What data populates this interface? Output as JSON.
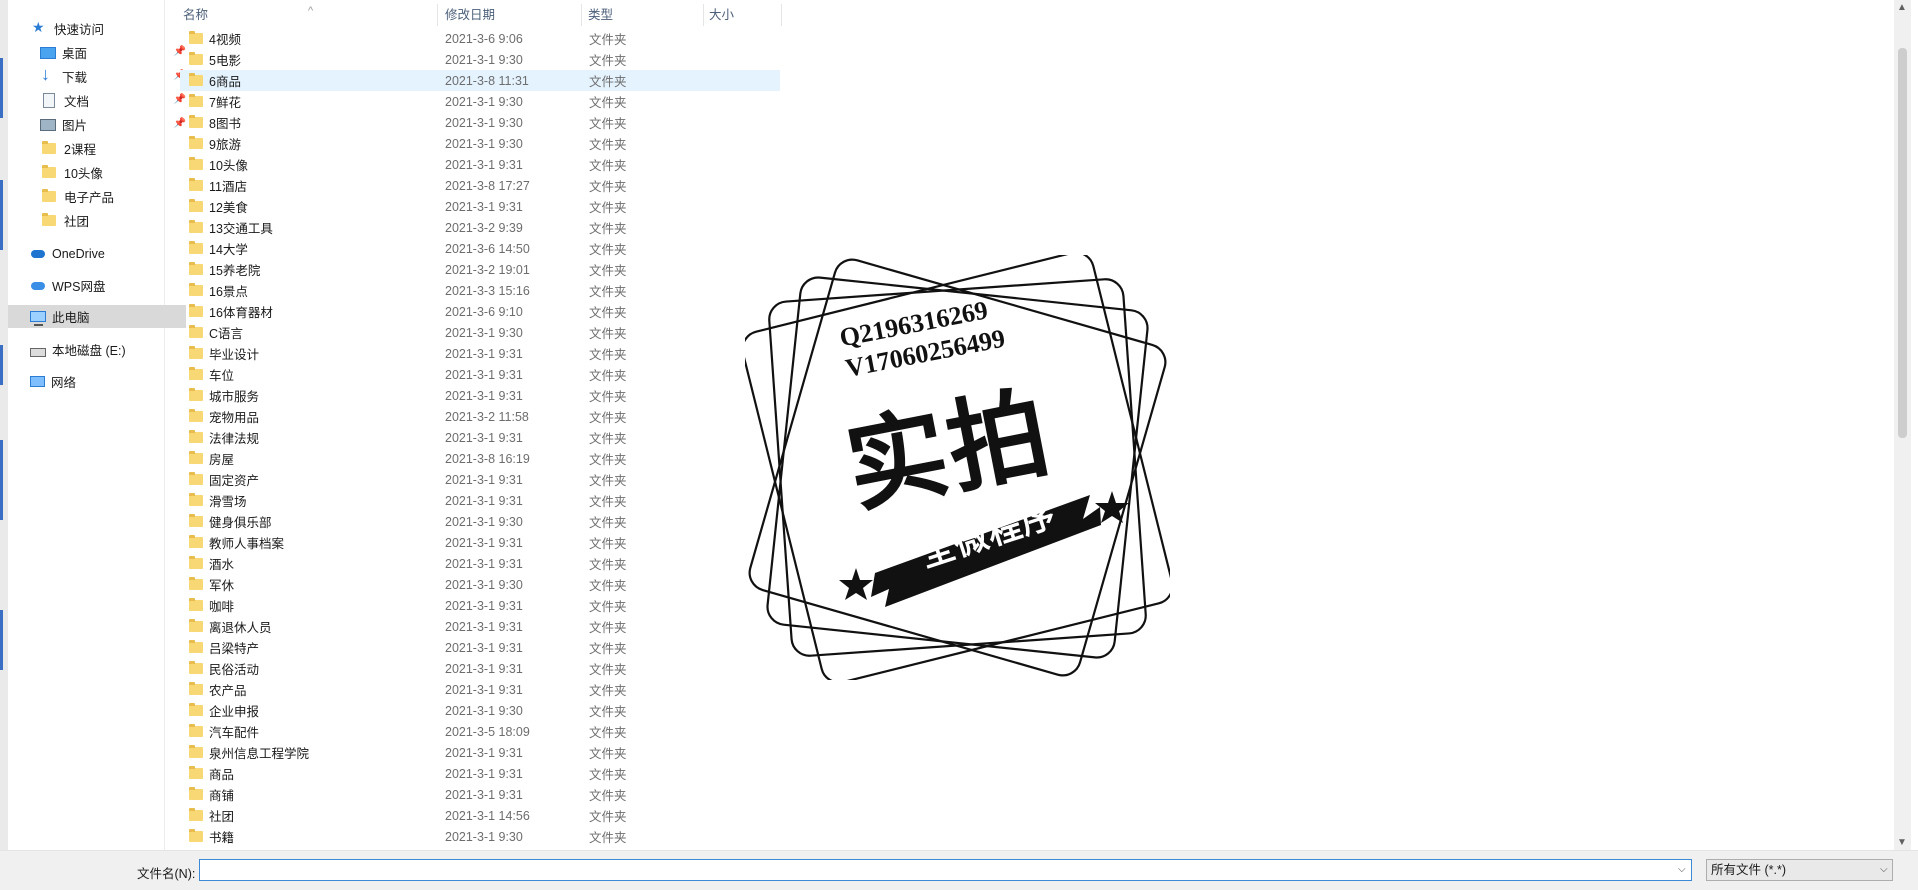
{
  "nav": {
    "quick_access": "快速访问",
    "items": [
      {
        "label": "桌面",
        "icon": "desktop-icon",
        "pinned": true
      },
      {
        "label": "下载",
        "icon": "download-icon",
        "pinned": true
      },
      {
        "label": "文档",
        "icon": "document-icon",
        "pinned": true
      },
      {
        "label": "图片",
        "icon": "pictures-icon",
        "pinned": true
      },
      {
        "label": "2课程",
        "icon": "folder-icon"
      },
      {
        "label": "10头像",
        "icon": "folder-icon"
      },
      {
        "label": "电子产品",
        "icon": "folder-icon"
      },
      {
        "label": "社团",
        "icon": "folder-icon"
      }
    ],
    "onedrive": "OneDrive",
    "wps": "WPS网盘",
    "this_pc": "此电脑",
    "local_disk": "本地磁盘 (E:)",
    "network": "网络",
    "pin_glyph": "📌"
  },
  "columns": {
    "name": "名称",
    "date": "修改日期",
    "type": "类型",
    "size": "大小"
  },
  "rows": [
    {
      "name": "4视频",
      "date": "2021-3-6 9:06",
      "type": "文件夹"
    },
    {
      "name": "5电影",
      "date": "2021-3-1 9:30",
      "type": "文件夹"
    },
    {
      "name": "6商品",
      "date": "2021-3-8 11:31",
      "type": "文件夹"
    },
    {
      "name": "7鲜花",
      "date": "2021-3-1 9:30",
      "type": "文件夹"
    },
    {
      "name": "8图书",
      "date": "2021-3-1 9:30",
      "type": "文件夹"
    },
    {
      "name": "9旅游",
      "date": "2021-3-1 9:30",
      "type": "文件夹"
    },
    {
      "name": "10头像",
      "date": "2021-3-1 9:31",
      "type": "文件夹"
    },
    {
      "name": "11酒店",
      "date": "2021-3-8 17:27",
      "type": "文件夹"
    },
    {
      "name": "12美食",
      "date": "2021-3-1 9:31",
      "type": "文件夹"
    },
    {
      "name": "13交通工具",
      "date": "2021-3-2 9:39",
      "type": "文件夹"
    },
    {
      "name": "14大学",
      "date": "2021-3-6 14:50",
      "type": "文件夹"
    },
    {
      "name": "15养老院",
      "date": "2021-3-2 19:01",
      "type": "文件夹"
    },
    {
      "name": "16景点",
      "date": "2021-3-3 15:16",
      "type": "文件夹"
    },
    {
      "name": "16体育器材",
      "date": "2021-3-6 9:10",
      "type": "文件夹"
    },
    {
      "name": "C语言",
      "date": "2021-3-1 9:30",
      "type": "文件夹"
    },
    {
      "name": "毕业设计",
      "date": "2021-3-1 9:31",
      "type": "文件夹"
    },
    {
      "name": "车位",
      "date": "2021-3-1 9:31",
      "type": "文件夹"
    },
    {
      "name": "城市服务",
      "date": "2021-3-1 9:31",
      "type": "文件夹"
    },
    {
      "name": "宠物用品",
      "date": "2021-3-2 11:58",
      "type": "文件夹"
    },
    {
      "name": "法律法规",
      "date": "2021-3-1 9:31",
      "type": "文件夹"
    },
    {
      "name": "房屋",
      "date": "2021-3-8 16:19",
      "type": "文件夹"
    },
    {
      "name": "固定资产",
      "date": "2021-3-1 9:31",
      "type": "文件夹"
    },
    {
      "name": "滑雪场",
      "date": "2021-3-1 9:31",
      "type": "文件夹"
    },
    {
      "name": "健身俱乐部",
      "date": "2021-3-1 9:30",
      "type": "文件夹"
    },
    {
      "name": "教师人事档案",
      "date": "2021-3-1 9:31",
      "type": "文件夹"
    },
    {
      "name": "酒水",
      "date": "2021-3-1 9:31",
      "type": "文件夹"
    },
    {
      "name": "军休",
      "date": "2021-3-1 9:30",
      "type": "文件夹"
    },
    {
      "name": "咖啡",
      "date": "2021-3-1 9:31",
      "type": "文件夹"
    },
    {
      "name": "离退休人员",
      "date": "2021-3-1 9:31",
      "type": "文件夹"
    },
    {
      "name": "吕梁特产",
      "date": "2021-3-1 9:31",
      "type": "文件夹"
    },
    {
      "name": "民俗活动",
      "date": "2021-3-1 9:31",
      "type": "文件夹"
    },
    {
      "name": "农产品",
      "date": "2021-3-1 9:31",
      "type": "文件夹"
    },
    {
      "name": "企业申报",
      "date": "2021-3-1 9:30",
      "type": "文件夹"
    },
    {
      "name": "汽车配件",
      "date": "2021-3-5 18:09",
      "type": "文件夹"
    },
    {
      "name": "泉州信息工程学院",
      "date": "2021-3-1 9:31",
      "type": "文件夹"
    },
    {
      "name": "商品",
      "date": "2021-3-1 9:31",
      "type": "文件夹"
    },
    {
      "name": "商铺",
      "date": "2021-3-1 9:31",
      "type": "文件夹"
    },
    {
      "name": "社团",
      "date": "2021-3-1 14:56",
      "type": "文件夹"
    },
    {
      "name": "书籍",
      "date": "2021-3-1 9:30",
      "type": "文件夹"
    }
  ],
  "hovered_row": 2,
  "bottom": {
    "filename_label": "文件名(N):",
    "filename_value": "",
    "filetype_value": "所有文件 (*.*)"
  },
  "watermark": {
    "line1": "Q2196316269",
    "line2": "V17060256499",
    "main": "实拍",
    "banner": "全微程序"
  },
  "colors": {
    "accent": "#2b7cd3",
    "hover": "#e5f3ff",
    "selected": "#d9d9d9",
    "folder": "#f8d775"
  }
}
